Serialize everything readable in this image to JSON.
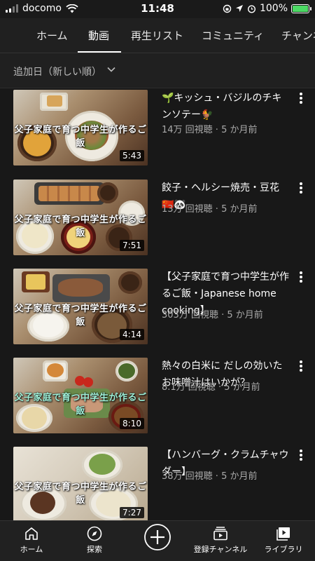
{
  "status_bar": {
    "carrier": "docomo",
    "time": "11:48",
    "battery": "100%",
    "battery_level": 1.0
  },
  "tabs": [
    {
      "label": "ホーム"
    },
    {
      "label": "動画"
    },
    {
      "label": "再生リスト"
    },
    {
      "label": "コミュニティ"
    },
    {
      "label": "チャンネ"
    }
  ],
  "active_tab": "動画",
  "sort": {
    "label": "追加日（新しい順）"
  },
  "videos": [
    {
      "title": "🌱キッシュ・バジルのチキンソテー🐓",
      "meta": "14万 回視聴 · 5 か月前",
      "duration": "5:43",
      "overlay": "父子家庭で育つ中学生が作るご飯"
    },
    {
      "title": "餃子・ヘルシー焼売・豆花🇨🇳🐼",
      "meta": "13万 回視聴 · 5 か月前",
      "duration": "7:51",
      "overlay": "父子家庭で育つ中学生が作るご飯"
    },
    {
      "title": "【父子家庭で育つ中学生が作るご飯・Japanese home cooking】",
      "meta": "303万 回視聴 · 5 か月前",
      "duration": "4:14",
      "overlay": "父子家庭で育つ中学生が作るご飯"
    },
    {
      "title": "熱々の白米に だしの効いたお味噌汁はいかが？",
      "meta": "8.1万 回視聴 · 5 か月前",
      "duration": "8:10",
      "overlay": "父子家庭で育つ中学生が作るご飯"
    },
    {
      "title": "【ハンバーグ・クラムチャウダー】",
      "meta": "38万 回視聴 · 5 か月前",
      "duration": "7:27",
      "overlay": "父子家庭で育つ中学生が作るご飯"
    }
  ],
  "bottom_nav": [
    {
      "label": "ホーム",
      "icon": "home-icon"
    },
    {
      "label": "探索",
      "icon": "compass-icon"
    },
    {
      "label": "",
      "icon": "create-plus-icon"
    },
    {
      "label": "登録チャンネル",
      "icon": "subscriptions-icon"
    },
    {
      "label": "ライブラリ",
      "icon": "library-icon"
    }
  ],
  "colors": {
    "background": "#181818",
    "header": "#202020",
    "battery": "#4cd964",
    "meta_text": "#aaaaaa"
  }
}
